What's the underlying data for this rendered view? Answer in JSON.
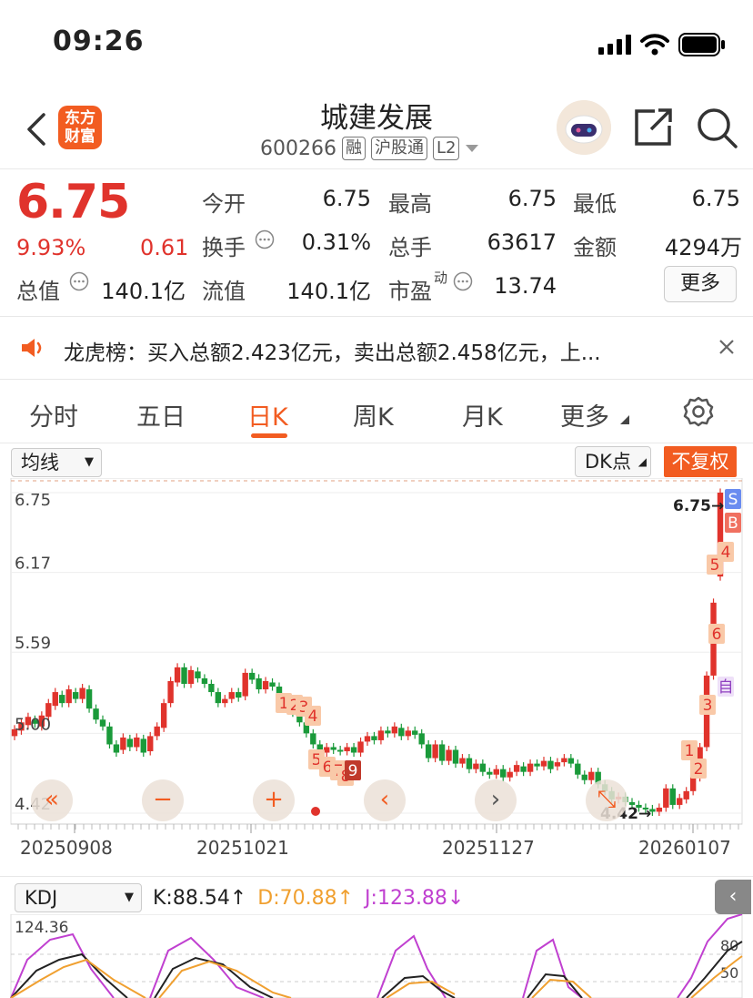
{
  "status_bar": {
    "time": "09:26"
  },
  "header": {
    "logo_line1": "东方",
    "logo_line2": "财富",
    "stock_name": "城建发展",
    "stock_code": "600266",
    "tags": [
      "融",
      "沪股通",
      "L2"
    ]
  },
  "quote": {
    "price": "6.75",
    "change_pct": "9.93%",
    "change": "0.61",
    "fields": [
      {
        "label": "今开",
        "value": "6.75",
        "color": "#e0332c"
      },
      {
        "label": "最高",
        "value": "6.75",
        "color": "#e0332c"
      },
      {
        "label": "最低",
        "value": "6.75",
        "color": "#e0332c"
      },
      {
        "label": "换手",
        "value": "0.31%",
        "color": "#222"
      },
      {
        "label": "总手",
        "value": "63617",
        "color": "#222"
      },
      {
        "label": "金额",
        "value": "4294万",
        "color": "#222"
      },
      {
        "label": "总值",
        "value": "140.1亿",
        "color": "#222"
      },
      {
        "label": "流值",
        "value": "140.1亿",
        "color": "#222"
      },
      {
        "label": "市盈",
        "value": "13.74",
        "color": "#222"
      }
    ],
    "pe_superscript": "动",
    "more_label": "更多"
  },
  "notice": {
    "text": "龙虎榜：买入总额2.423亿元，卖出总额2.458亿元，上..."
  },
  "tabs": [
    "分时",
    "五日",
    "日K",
    "周K",
    "月K",
    "更多"
  ],
  "active_tab": "日K",
  "chart_toolbar": {
    "ma_label": "均线",
    "dk_label": "DK点",
    "adjust_label": "不复权"
  },
  "chart_data": {
    "type": "candlestick",
    "y_ticks": [
      "6.75",
      "6.17",
      "5.59",
      "5.00",
      "4.42"
    ],
    "ylim": [
      4.42,
      6.75
    ],
    "x_ticks": [
      "20250908",
      "20251021",
      "20251127",
      "20260107"
    ],
    "high_marker": "6.75",
    "low_marker": "4.42",
    "up_color": "#e0332c",
    "down_color": "#1a9a3a",
    "candles": [
      [
        4.98,
        5.03
      ],
      [
        5.02,
        5.08
      ],
      [
        5.06,
        5.12
      ],
      [
        5.1,
        5.07
      ],
      [
        5.05,
        5.13
      ],
      [
        5.12,
        5.22
      ],
      [
        5.2,
        5.3
      ],
      [
        5.28,
        5.22
      ],
      [
        5.22,
        5.32
      ],
      [
        5.3,
        5.25
      ],
      [
        5.25,
        5.33
      ],
      [
        5.32,
        5.18
      ],
      [
        5.18,
        5.1
      ],
      [
        5.1,
        5.05
      ],
      [
        5.05,
        4.92
      ],
      [
        4.92,
        4.86
      ],
      [
        4.88,
        4.97
      ],
      [
        4.96,
        4.9
      ],
      [
        4.9,
        4.97
      ],
      [
        4.96,
        4.86
      ],
      [
        4.87,
        4.98
      ],
      [
        4.98,
        5.05
      ],
      [
        5.04,
        5.22
      ],
      [
        5.22,
        5.38
      ],
      [
        5.37,
        5.48
      ],
      [
        5.48,
        5.36
      ],
      [
        5.36,
        5.46
      ],
      [
        5.45,
        5.4
      ],
      [
        5.4,
        5.36
      ],
      [
        5.36,
        5.3
      ],
      [
        5.3,
        5.22
      ],
      [
        5.22,
        5.25
      ],
      [
        5.25,
        5.3
      ],
      [
        5.3,
        5.26
      ],
      [
        5.27,
        5.44
      ],
      [
        5.44,
        5.39
      ],
      [
        5.4,
        5.32
      ],
      [
        5.32,
        5.38
      ],
      [
        5.37,
        5.34
      ],
      [
        5.34,
        5.24
      ],
      [
        5.24,
        5.2
      ],
      [
        5.2,
        5.15
      ],
      [
        5.15,
        5.08
      ],
      [
        5.08,
        5.0
      ],
      [
        5.0,
        4.92
      ],
      [
        4.92,
        4.86
      ],
      [
        4.86,
        4.9
      ],
      [
        4.9,
        4.88
      ],
      [
        4.88,
        4.87
      ],
      [
        4.87,
        4.9
      ],
      [
        4.9,
        4.86
      ],
      [
        4.86,
        4.94
      ],
      [
        4.94,
        4.98
      ],
      [
        4.98,
        4.95
      ],
      [
        4.95,
        5.02
      ],
      [
        5.02,
        5.0
      ],
      [
        5.0,
        5.05
      ],
      [
        5.04,
        4.98
      ],
      [
        4.98,
        5.02
      ],
      [
        5.02,
        4.99
      ],
      [
        5.0,
        4.92
      ],
      [
        4.92,
        4.82
      ],
      [
        4.82,
        4.92
      ],
      [
        4.92,
        4.8
      ],
      [
        4.8,
        4.88
      ],
      [
        4.88,
        4.78
      ],
      [
        4.78,
        4.82
      ],
      [
        4.82,
        4.74
      ],
      [
        4.74,
        4.78
      ],
      [
        4.78,
        4.72
      ],
      [
        4.72,
        4.7
      ],
      [
        4.7,
        4.74
      ],
      [
        4.74,
        4.68
      ],
      [
        4.68,
        4.72
      ],
      [
        4.72,
        4.77
      ],
      [
        4.76,
        4.72
      ],
      [
        4.72,
        4.78
      ],
      [
        4.78,
        4.76
      ],
      [
        4.76,
        4.8
      ],
      [
        4.8,
        4.74
      ],
      [
        4.76,
        4.79
      ],
      [
        4.79,
        4.82
      ],
      [
        4.82,
        4.78
      ],
      [
        4.78,
        4.7
      ],
      [
        4.7,
        4.66
      ],
      [
        4.66,
        4.72
      ],
      [
        4.72,
        4.63
      ],
      [
        4.63,
        4.58
      ],
      [
        4.58,
        4.52
      ],
      [
        4.52,
        4.54
      ],
      [
        4.54,
        4.5
      ],
      [
        4.5,
        4.48
      ],
      [
        4.48,
        4.46
      ],
      [
        4.46,
        4.45
      ],
      [
        4.45,
        4.43
      ],
      [
        4.43,
        4.46
      ],
      [
        4.46,
        4.6
      ],
      [
        4.6,
        4.48
      ],
      [
        4.48,
        4.53
      ],
      [
        4.52,
        4.58
      ],
      [
        4.58,
        4.7
      ],
      [
        4.68,
        4.9
      ],
      [
        4.9,
        5.42
      ],
      [
        5.42,
        5.95
      ],
      [
        6.14,
        6.75
      ]
    ],
    "signals": [
      "1",
      "2",
      "3",
      "4",
      "5",
      "6",
      "7",
      "8",
      "9",
      "1",
      "2",
      "3",
      "4",
      "5",
      "6",
      "自",
      "B",
      "S"
    ]
  },
  "indicator": {
    "name": "KDJ",
    "k": "K:88.54",
    "d": "D:70.88",
    "j": "J:123.88",
    "k_color": "#222",
    "d_color": "#f0a030",
    "j_color": "#c040d0",
    "y_top": "124.36",
    "ref_80": "80",
    "ref_50": "50"
  }
}
